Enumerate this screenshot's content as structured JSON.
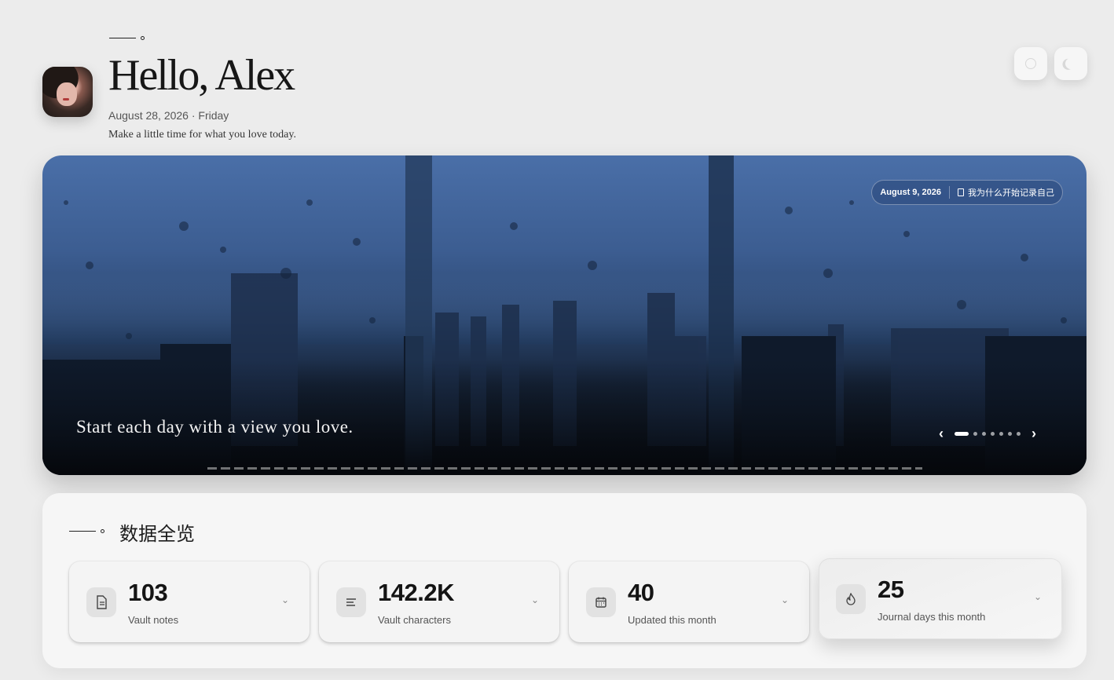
{
  "header": {
    "greeting": "Hello, Alex",
    "date": "August 28, 2026 · Friday",
    "subtitle": "Make a little time for what you love today."
  },
  "top_buttons": [
    {
      "icon": "circle-icon"
    },
    {
      "icon": "moon-icon"
    }
  ],
  "hero": {
    "badge_date": "August 9, 2026",
    "badge_entry": "我为什么开始记录自己",
    "caption": "Start each day with a view you love.",
    "slides_count": 7,
    "active_slide": 1
  },
  "stats": {
    "title": "数据全览",
    "cards": [
      {
        "value": "103",
        "label": "Vault notes",
        "icon": "document-icon"
      },
      {
        "value": "142.2K",
        "label": "Vault characters",
        "icon": "lines-icon"
      },
      {
        "value": "40",
        "label": "Updated this month",
        "icon": "calendar-icon"
      },
      {
        "value": "25",
        "label": "Journal days this month",
        "icon": "flame-icon"
      }
    ]
  }
}
